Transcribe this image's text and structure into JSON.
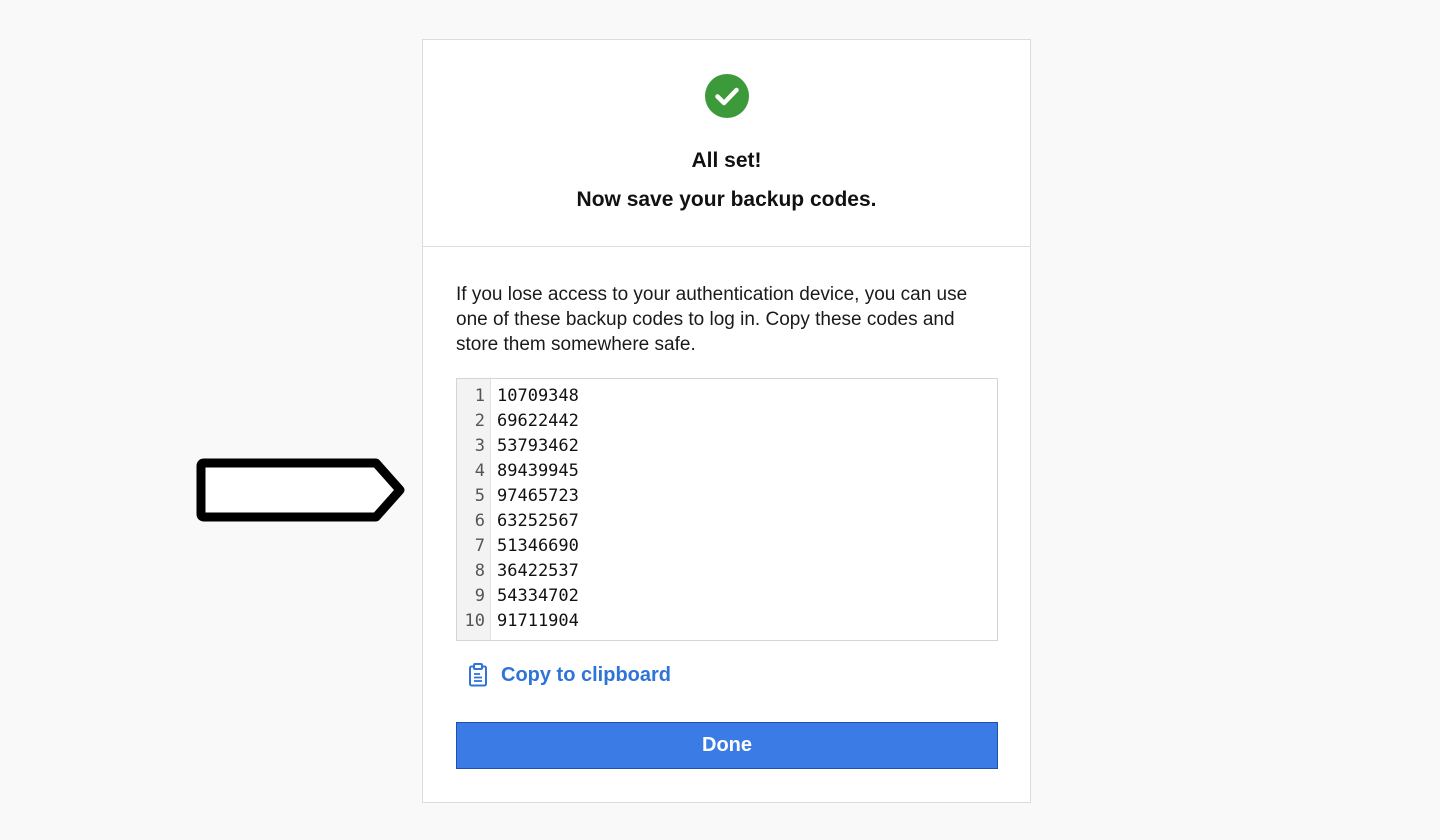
{
  "annotation": {
    "shape": "arrow-tag-pointing-right",
    "stroke_color": "#000000"
  },
  "header": {
    "icon": "check-circle-icon",
    "icon_color": "#3d9a3a",
    "title": "All set!",
    "subtitle": "Now save your backup codes."
  },
  "body": {
    "description": "If you lose access to your authentication device, you can use one of these backup codes to log in. Copy these codes and store them somewhere safe.",
    "codes": [
      {
        "line": "1",
        "code": "10709348"
      },
      {
        "line": "2",
        "code": "69622442"
      },
      {
        "line": "3",
        "code": "53793462"
      },
      {
        "line": "4",
        "code": "89439945"
      },
      {
        "line": "5",
        "code": "97465723"
      },
      {
        "line": "6",
        "code": "63252567"
      },
      {
        "line": "7",
        "code": "51346690"
      },
      {
        "line": "8",
        "code": "36422537"
      },
      {
        "line": "9",
        "code": "54334702"
      },
      {
        "line": "10",
        "code": "91711904"
      }
    ],
    "copy_label": "Copy to clipboard",
    "copy_icon": "clipboard-icon",
    "done_label": "Done",
    "accent_color": "#3a7be6"
  }
}
